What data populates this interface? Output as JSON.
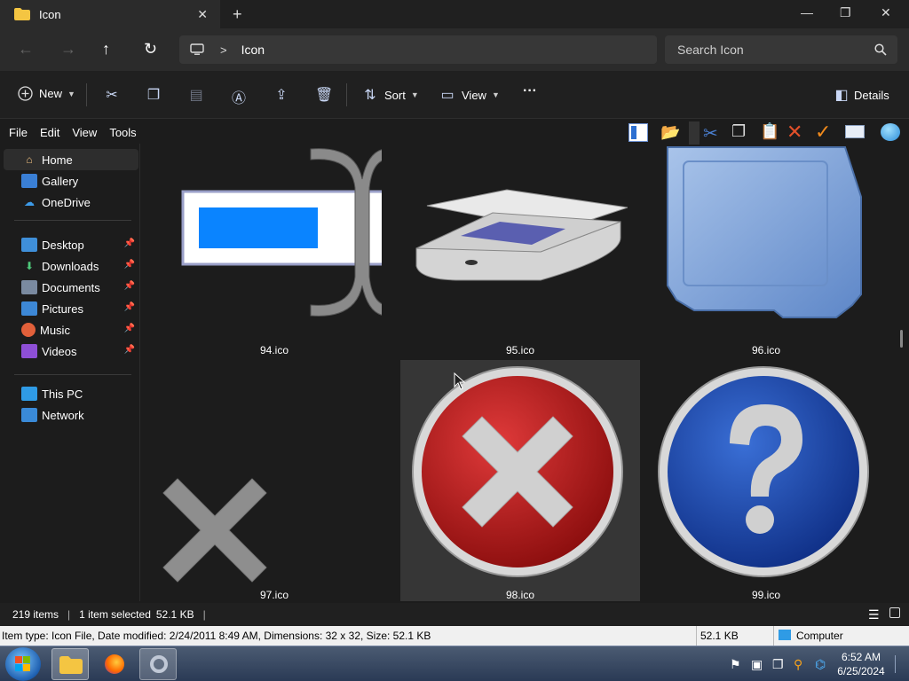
{
  "tab": {
    "title": "Icon",
    "close": "✕",
    "new_tab": "+"
  },
  "window": {
    "minimize": "—",
    "maximize": "❐",
    "close": "✕"
  },
  "nav": {
    "back": "←",
    "forward": "→",
    "up": "↑",
    "refresh": "↻"
  },
  "address": {
    "separator": ">",
    "path": "Icon"
  },
  "search": {
    "placeholder": "Search Icon"
  },
  "commands": {
    "new": "New",
    "sort": "Sort",
    "view": "View",
    "more": "···",
    "details": "Details"
  },
  "menu": [
    "File",
    "Edit",
    "View",
    "Tools"
  ],
  "sidebar": {
    "home": "Home",
    "gallery": "Gallery",
    "onedrive": "OneDrive",
    "desktop": "Desktop",
    "downloads": "Downloads",
    "documents": "Documents",
    "pictures": "Pictures",
    "music": "Music",
    "videos": "Videos",
    "thispc": "This PC",
    "network": "Network"
  },
  "files": [
    {
      "name": "94.ico"
    },
    {
      "name": "95.ico"
    },
    {
      "name": "96.ico"
    },
    {
      "name": "97.ico"
    },
    {
      "name": "98.ico",
      "selected": true
    },
    {
      "name": "99.ico"
    }
  ],
  "status": {
    "items": "219 items",
    "selected": "1 item selected",
    "size": "52.1 KB"
  },
  "details_bar": {
    "info": "Item type: Icon File, Date modified: 2/24/2011 8:49 AM, Dimensions: 32 x 32, Size: 52.1 KB",
    "size": "52.1 KB",
    "location": "Computer"
  },
  "clock": {
    "time": "6:52 AM",
    "date": "6/25/2024"
  },
  "colors": {
    "accent": "#0078d4",
    "selected_tile": "#363636",
    "folder": "#f4c542"
  }
}
